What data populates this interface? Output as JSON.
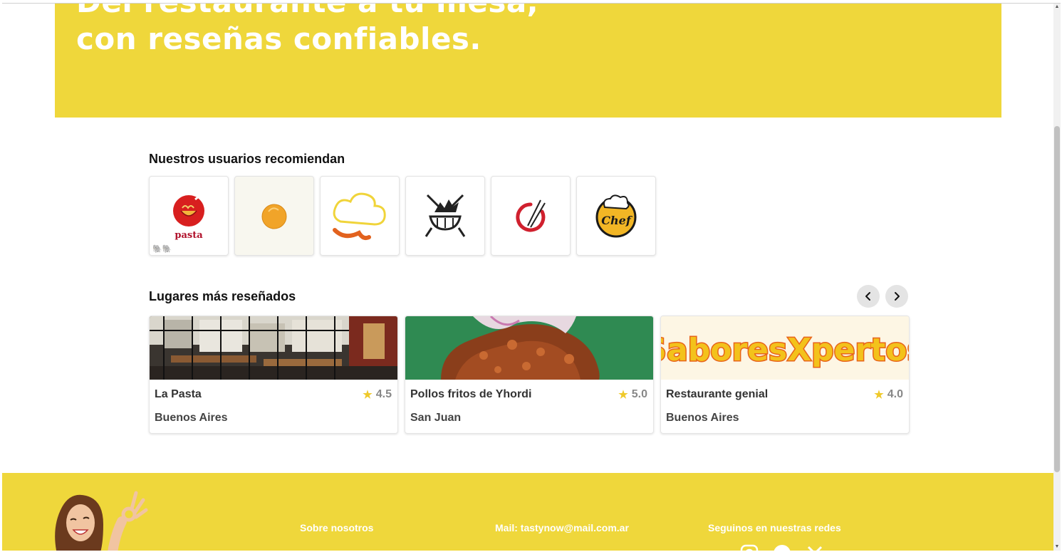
{
  "hero": {
    "title_line1": "Del restaurante a tu mesa,",
    "title_line2": "con reseñas confiables."
  },
  "recommend": {
    "title": "Nuestros usuarios recomiendan",
    "logos": [
      {
        "name": "pasta-logo",
        "text": "pasta"
      },
      {
        "name": "orange-chicken-logo",
        "text": ""
      },
      {
        "name": "chef-hat-logo",
        "text": ""
      },
      {
        "name": "grill-logo",
        "text": ""
      },
      {
        "name": "chopsticks-logo",
        "text": ""
      },
      {
        "name": "chef-badge-logo",
        "text": "Chef"
      }
    ]
  },
  "places": {
    "title": "Lugares más reseñados",
    "items": [
      {
        "name": "La Pasta",
        "rating": "4.5",
        "city": "Buenos Aires"
      },
      {
        "name": "Pollos fritos de Yhordi",
        "rating": "5.0",
        "city": "San Juan"
      },
      {
        "name": "Restaurante genial",
        "rating": "4.0",
        "city": "Buenos Aires",
        "banner_text": "SaboresXpertos"
      }
    ]
  },
  "footer": {
    "about": "Sobre nosotros",
    "mail": "Mail: tastynow@mail.com.ar",
    "social": "Seguinos en nuestras redes"
  },
  "colors": {
    "brand_yellow": "#efd73b",
    "star": "#efc92a"
  }
}
